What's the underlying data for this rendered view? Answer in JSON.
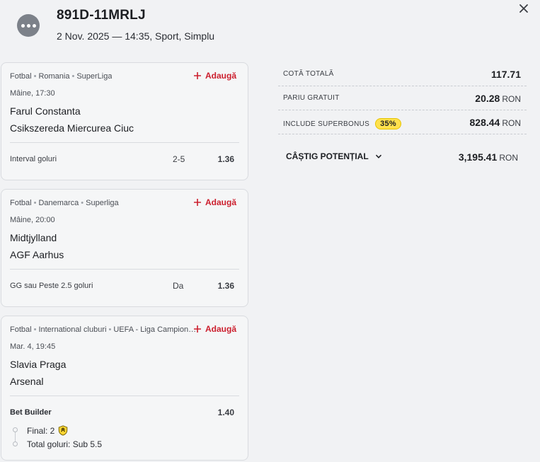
{
  "header": {
    "ticket_id": "891D-11MRLJ",
    "subtitle": "2 Nov. 2025 — 14:35, Sport, Simplu",
    "menu_icon": "more-dots-icon",
    "close_icon": "close-icon"
  },
  "add_label": "Adaugă",
  "bets": [
    {
      "sport": "Fotbal",
      "country": "Romania",
      "league": "SuperLiga",
      "time": "Mâine, 17:30",
      "home": "Farul Constanta",
      "away": "Csikszereda Miercurea Ciuc",
      "market": "Interval goluri",
      "pick": "2-5",
      "odd": "1.36"
    },
    {
      "sport": "Fotbal",
      "country": "Danemarca",
      "league": "Superliga",
      "time": "Mâine, 20:00",
      "home": "Midtjylland",
      "away": "AGF Aarhus",
      "market": "GG sau Peste 2.5 goluri",
      "pick": "Da",
      "odd": "1.36"
    },
    {
      "sport": "Fotbal",
      "country": "International cluburi",
      "league": "UEFA - Liga Campionilor",
      "time": "Mar. 4, 19:45",
      "home": "Slavia Praga",
      "away": "Arsenal",
      "market": "Bet Builder",
      "odd": "1.40",
      "builder": [
        "Final: 2",
        "Total goluri: Sub 5.5"
      ]
    }
  ],
  "summary": {
    "total_odds_label": "COTĂ TOTALĂ",
    "total_odds": "117.71",
    "free_bet_label": "PARIU GRATUIT",
    "free_bet": "20.28",
    "superbonus_label": "INCLUDE SUPERBONUS",
    "superbonus_pct": "35%",
    "superbonus": "828.44",
    "currency": "RON",
    "potential_label": "CÂȘTIG POTENȚIAL",
    "potential": "3,195.41"
  },
  "colors": {
    "accent_red": "#cc1f2e",
    "badge_yellow": "#ffe14d"
  }
}
